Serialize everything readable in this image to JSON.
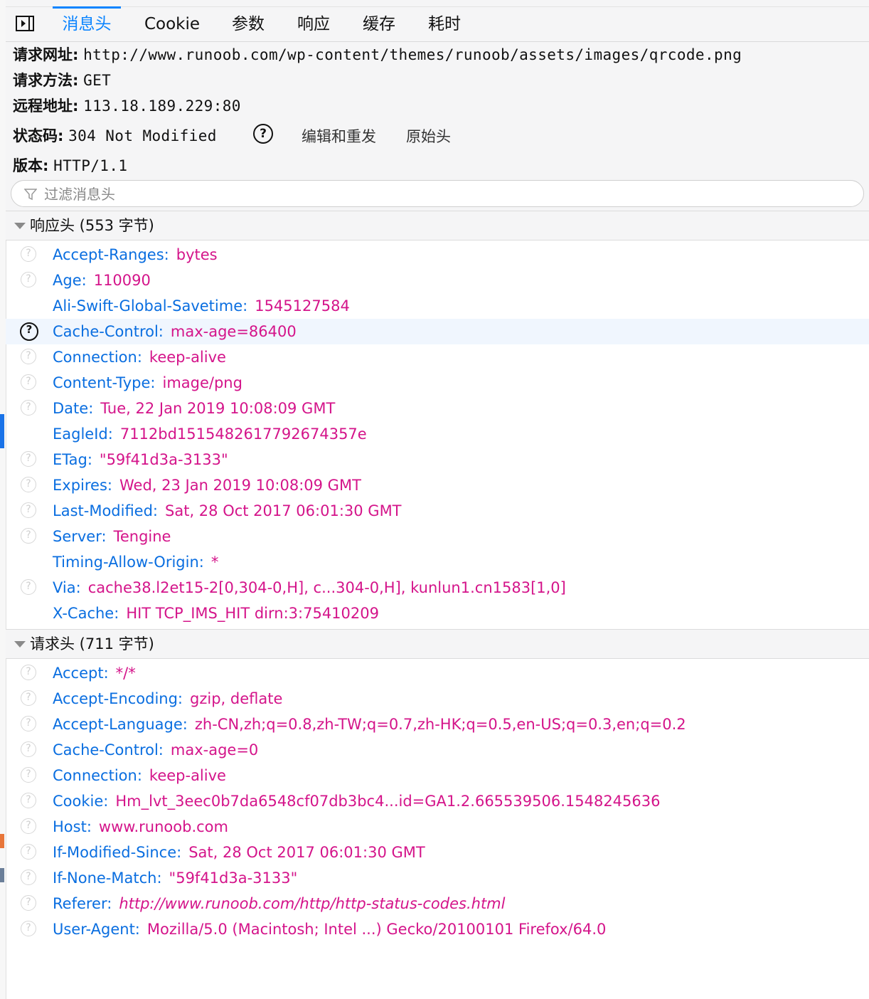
{
  "tabs": [
    "消息头",
    "Cookie",
    "参数",
    "响应",
    "缓存",
    "耗时"
  ],
  "active_tab": "消息头",
  "summary": {
    "url_label": "请求网址:",
    "url_value": "http://www.runoob.com/wp-content/themes/runoob/assets/images/qrcode.png",
    "method_label": "请求方法:",
    "method_value": "GET",
    "remote_label": "远程地址:",
    "remote_value": "113.18.189.229:80",
    "status_label": "状态码:",
    "status_value": "304 Not Modified",
    "help_glyph": "?",
    "edit_resend": "编辑和重发",
    "raw_headers": "原始头",
    "version_label": "版本:",
    "version_value": "HTTP/1.1"
  },
  "filter": {
    "placeholder": "过滤消息头"
  },
  "response_section": {
    "title": "响应头 (553 字节)",
    "headers": [
      {
        "name": "Accept-Ranges:",
        "value": "bytes",
        "help": true
      },
      {
        "name": "Age:",
        "value": "110090",
        "help": true
      },
      {
        "name": "Ali-Swift-Global-Savetime:",
        "value": "1545127584",
        "help": false
      },
      {
        "name": "Cache-Control:",
        "value": "max-age=86400",
        "help": true,
        "selected": true
      },
      {
        "name": "Connection:",
        "value": "keep-alive",
        "help": true
      },
      {
        "name": "Content-Type:",
        "value": "image/png",
        "help": true
      },
      {
        "name": "Date:",
        "value": "Tue, 22 Jan 2019 10:08:09 GMT",
        "help": true
      },
      {
        "name": "EagleId:",
        "value": "7112bd1515482617792674357e",
        "help": false
      },
      {
        "name": "ETag:",
        "value": "\"59f41d3a-3133\"",
        "help": true
      },
      {
        "name": "Expires:",
        "value": "Wed, 23 Jan 2019 10:08:09 GMT",
        "help": true
      },
      {
        "name": "Last-Modified:",
        "value": "Sat, 28 Oct 2017 06:01:30 GMT",
        "help": true
      },
      {
        "name": "Server:",
        "value": "Tengine",
        "help": true
      },
      {
        "name": "Timing-Allow-Origin:",
        "value": "*",
        "help": false
      },
      {
        "name": "Via:",
        "value": "cache38.l2et15-2[0,304-0,H], c...304-0,H], kunlun1.cn1583[1,0]",
        "help": true
      },
      {
        "name": "X-Cache:",
        "value": "HIT TCP_IMS_HIT dirn:3:75410209",
        "help": false
      }
    ]
  },
  "request_section": {
    "title": "请求头 (711 字节)",
    "headers": [
      {
        "name": "Accept:",
        "value": "*/*",
        "help": true
      },
      {
        "name": "Accept-Encoding:",
        "value": "gzip, deflate",
        "help": true
      },
      {
        "name": "Accept-Language:",
        "value": "zh-CN,zh;q=0.8,zh-TW;q=0.7,zh-HK;q=0.5,en-US;q=0.3,en;q=0.2",
        "help": true
      },
      {
        "name": "Cache-Control:",
        "value": "max-age=0",
        "help": true
      },
      {
        "name": "Connection:",
        "value": "keep-alive",
        "help": true
      },
      {
        "name": "Cookie:",
        "value": "Hm_lvt_3eec0b7da6548cf07db3bc4...id=GA1.2.665539506.1548245636",
        "help": true
      },
      {
        "name": "Host:",
        "value": "www.runoob.com",
        "help": true
      },
      {
        "name": "If-Modified-Since:",
        "value": "Sat, 28 Oct 2017 06:01:30 GMT",
        "help": true
      },
      {
        "name": "If-None-Match:",
        "value": "\"59f41d3a-3133\"",
        "help": true
      },
      {
        "name": "Referer:",
        "value": "http://www.runoob.com/http/http-status-codes.html",
        "help": true,
        "italic": true
      },
      {
        "name": "User-Agent:",
        "value": "Mozilla/5.0 (Macintosh; Intel ...) Gecko/20100101 Firefox/64.0",
        "help": true
      }
    ]
  },
  "colors": {
    "accent": "#0a84ff",
    "header_name": "#0a6ee0",
    "header_value": "#d4148a",
    "selected_row": "#f0f6fe"
  }
}
